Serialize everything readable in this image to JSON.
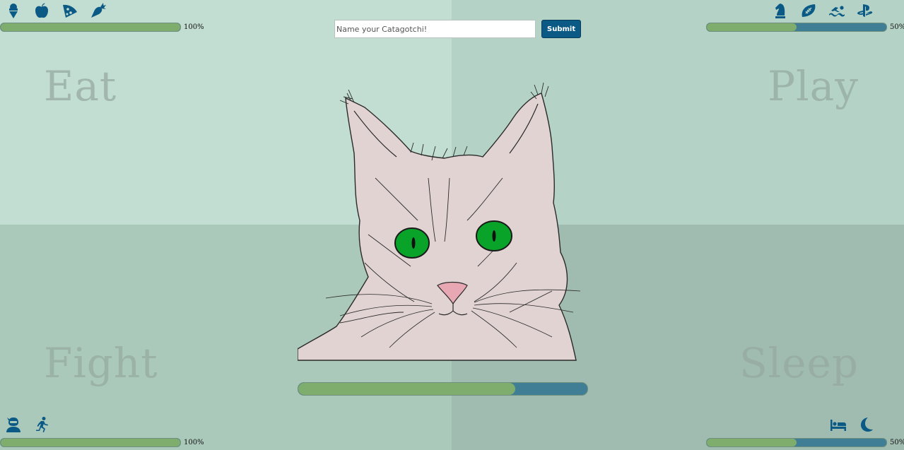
{
  "quadrants": {
    "eat": {
      "label": "Eat",
      "meter_pct": 100,
      "meter_text": "100%",
      "icons": [
        "ice-cream-icon",
        "apple-icon",
        "pizza-icon",
        "carrot-icon"
      ]
    },
    "play": {
      "label": "Play",
      "meter_pct": 50,
      "meter_text": "50%",
      "icons": [
        "chess-knight-icon",
        "football-icon",
        "swimmer-icon",
        "playstation-icon"
      ]
    },
    "fight": {
      "label": "Fight",
      "meter_pct": 100,
      "meter_text": "100%",
      "icons": [
        "ninja-icon",
        "running-icon"
      ]
    },
    "sleep": {
      "label": "Sleep",
      "meter_pct": 50,
      "meter_text": "50%",
      "icons": [
        "bed-icon",
        "moon-icon"
      ]
    }
  },
  "name_form": {
    "placeholder": "Name your Catagotchi!",
    "value": "",
    "submit_label": "Submit"
  },
  "overall_meter_pct": 75,
  "colors": {
    "accent": "#0b5a86",
    "meter_fill": "#7fad6e",
    "meter_track": "#3f7e95",
    "cat_eyes": "#0aa32a",
    "cat_fur": "#e1d3d2"
  }
}
